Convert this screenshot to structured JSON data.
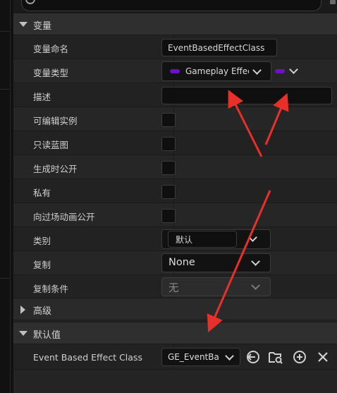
{
  "variable_section": {
    "title": "变量",
    "rows": {
      "name": {
        "label": "变量命名",
        "value": "EventBasedEffectClass"
      },
      "type": {
        "label": "变量类型",
        "value": "Gameplay Effect"
      },
      "description": {
        "label": "描述",
        "value": ""
      },
      "instance_editable": {
        "label": "可编辑实例",
        "checked": false
      },
      "blueprint_read_only": {
        "label": "只读蓝图",
        "checked": false
      },
      "expose_on_spawn": {
        "label": "生成时公开",
        "checked": false
      },
      "private": {
        "label": "私有",
        "checked": false
      },
      "expose_to_cinematics": {
        "label": "向过场动画公开",
        "checked": false
      },
      "category": {
        "label": "类别",
        "value": "默认"
      },
      "replication": {
        "label": "复制",
        "value": "None"
      },
      "replication_condition": {
        "label": "复制条件",
        "value": "无"
      }
    }
  },
  "advanced_section": {
    "title": "高级"
  },
  "default_value_section": {
    "title": "默认值",
    "row": {
      "label": "Event Based Effect Class",
      "value": "GE_EventBa"
    }
  },
  "colors": {
    "pin_purple": "#6a12c9",
    "annotation_red": "#e8302a",
    "panel_bg": "#242424"
  },
  "icons": [
    "search-icon",
    "chevron-down-icon",
    "chevron-right-icon",
    "use-selected-icon",
    "browse-icon",
    "add-icon",
    "clear-icon"
  ]
}
